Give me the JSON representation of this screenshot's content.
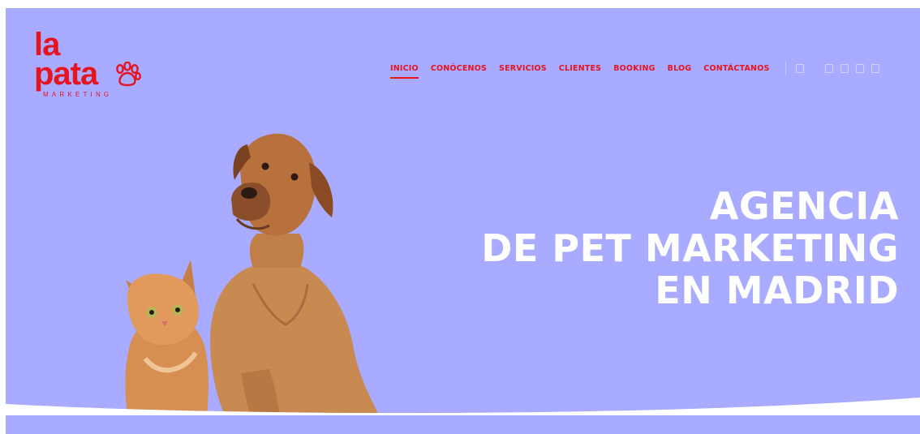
{
  "logo": {
    "line1": "la",
    "line2": "pata",
    "subtitle": "MARKETING"
  },
  "nav": {
    "items": [
      {
        "label": "INICIO",
        "active": true
      },
      {
        "label": "CONÓCENOS",
        "active": false
      },
      {
        "label": "SERVICIOS",
        "active": false
      },
      {
        "label": "CLIENTES",
        "active": false
      },
      {
        "label": "BOOKING",
        "active": false
      },
      {
        "label": "BLOG",
        "active": false
      },
      {
        "label": "CONTÁCTANOS",
        "active": false
      }
    ]
  },
  "hero": {
    "headline_lines": [
      "AGENCIA",
      "DE PET MARKETING",
      "EN MADRID"
    ],
    "image_icons": [
      "cat-image",
      "dog-image"
    ]
  },
  "colors": {
    "background": "#a8abff",
    "accent": "#e5141e",
    "headline": "#ffffff"
  }
}
